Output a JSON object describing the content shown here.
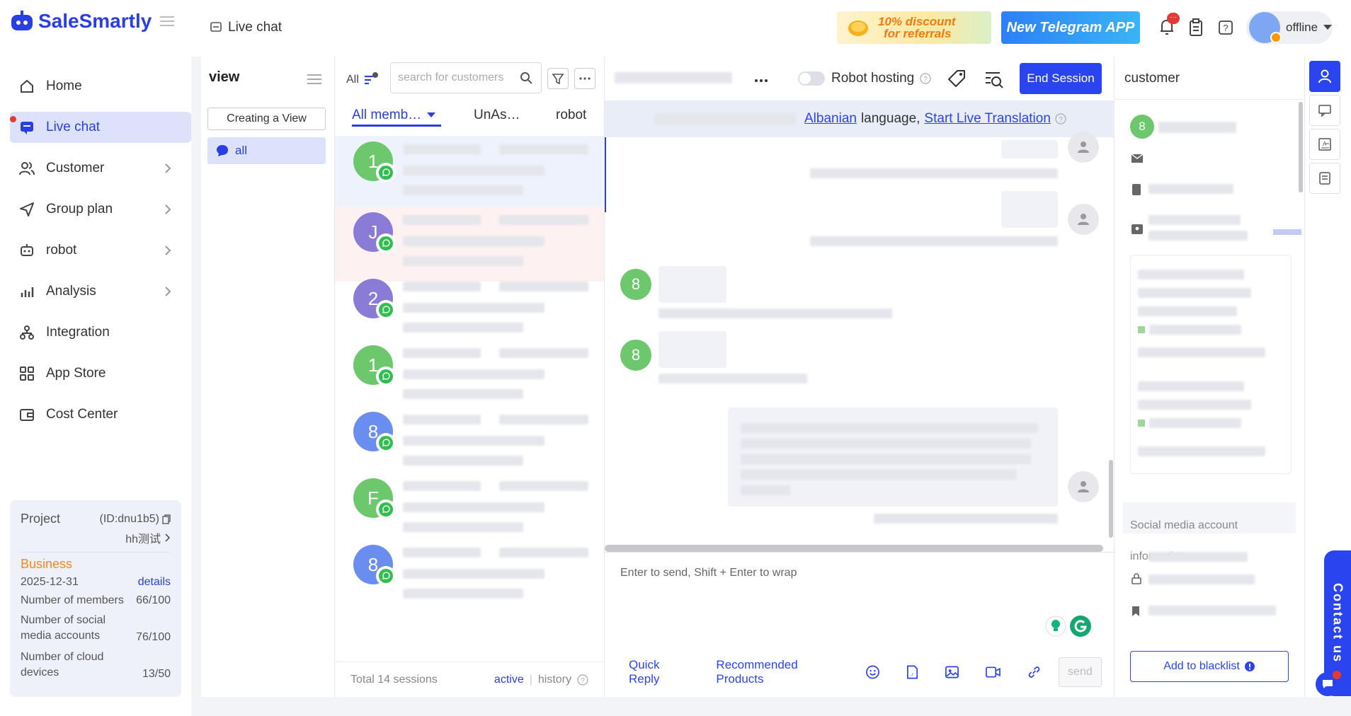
{
  "app": {
    "name": "SaleSmartly"
  },
  "nav": {
    "items": [
      {
        "label": "Home",
        "icon": "home-icon",
        "chevron": false
      },
      {
        "label": "Live chat",
        "icon": "chat-icon",
        "chevron": false,
        "active": true
      },
      {
        "label": "Customer",
        "icon": "users-icon",
        "chevron": true
      },
      {
        "label": "Group plan",
        "icon": "send-icon",
        "chevron": true
      },
      {
        "label": "robot",
        "icon": "robot-icon",
        "chevron": true
      },
      {
        "label": "Analysis",
        "icon": "bar-chart-icon",
        "chevron": true
      },
      {
        "label": "Integration",
        "icon": "integration-icon",
        "chevron": false
      },
      {
        "label": "App Store",
        "icon": "grid-icon",
        "chevron": false
      },
      {
        "label": "Cost Center",
        "icon": "wallet-icon",
        "chevron": false
      }
    ]
  },
  "project": {
    "label": "Project",
    "id": "(ID:dnu1b5)",
    "name": "hh测试",
    "plan": "Business",
    "expiry": "2025-12-31",
    "details_link": "details",
    "stats": [
      {
        "label": "Number of members",
        "value": "66/100"
      },
      {
        "label": "Number of social media accounts",
        "value": "76/100"
      },
      {
        "label": "Number of cloud devices",
        "value": "13/50"
      }
    ]
  },
  "header": {
    "breadcrumb": "Live chat",
    "promo1_line1": "10% discount",
    "promo1_line2": "for referrals",
    "promo2": "New Telegram APP",
    "notification_badge": "···",
    "user_status": "offline"
  },
  "view_panel": {
    "title": "view",
    "create_button": "Creating a View",
    "items": [
      {
        "label": "all"
      }
    ]
  },
  "session_list": {
    "filter_all": "All",
    "search_placeholder": "search for customers",
    "tabs": [
      "All memb…",
      "UnAs…",
      "robot"
    ],
    "sessions": [
      {
        "avatar": "1",
        "color": "#6dc76d"
      },
      {
        "avatar": "J",
        "color": "#8a7bd6"
      },
      {
        "avatar": "2",
        "color": "#8a7bd6"
      },
      {
        "avatar": "1",
        "color": "#6dc76d"
      },
      {
        "avatar": "8",
        "color": "#6a8df0"
      },
      {
        "avatar": "F",
        "color": "#6dc76d"
      },
      {
        "avatar": "8",
        "color": "#6a8df0"
      }
    ],
    "total": "Total 14 sessions",
    "active_link": "active",
    "history_link": "history"
  },
  "chat": {
    "robot_hosting_label": "Robot hosting",
    "end_session": "End Session",
    "translation": {
      "lang": "Albanian",
      "text": "language,",
      "link": "Start Live Translation"
    },
    "messages": [
      {
        "side": "right",
        "avatar": ""
      },
      {
        "side": "right",
        "avatar": ""
      },
      {
        "side": "left",
        "avatar": "8"
      },
      {
        "side": "left",
        "avatar": "8"
      },
      {
        "side": "right",
        "avatar": ""
      }
    ],
    "input_placeholder": "Enter to send, Shift + Enter to wrap",
    "quick_reply": "Quick Reply",
    "recommended": "Recommended Products",
    "send": "send"
  },
  "customer_panel": {
    "title": "customer",
    "avatar": "8",
    "social_section": "Social media account information",
    "blacklist_button": "Add to blacklist"
  },
  "contact": {
    "label": "Contact us"
  },
  "colors": {
    "brand": "#2a3fe0",
    "green_avatar": "#6dc76d",
    "purple_avatar": "#8a7bd6",
    "blue_avatar": "#6a8df0"
  }
}
